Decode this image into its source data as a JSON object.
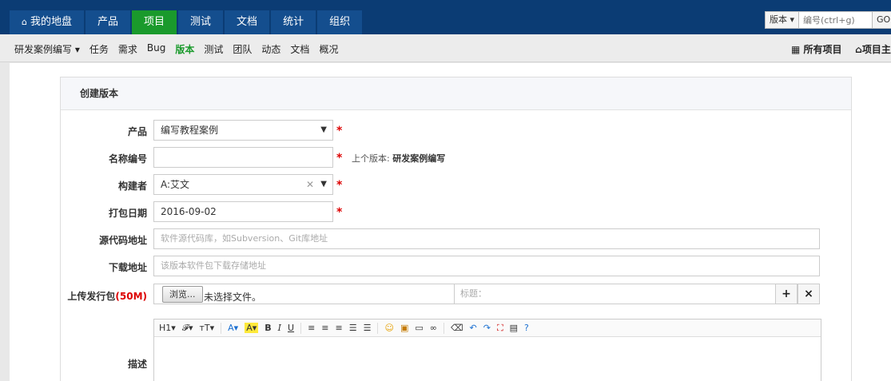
{
  "colors": {
    "topbar": "#0b3c74",
    "active_tab": "#1a9a2c",
    "required": "#dd0000"
  },
  "main_nav": [
    {
      "label": "我的地盘",
      "icon": "home-icon"
    },
    {
      "label": "产品"
    },
    {
      "label": "项目",
      "active": true
    },
    {
      "label": "测试"
    },
    {
      "label": "文档"
    },
    {
      "label": "统计"
    },
    {
      "label": "组织"
    }
  ],
  "search": {
    "type_label": "版本",
    "placeholder": "编号(ctrl+g)",
    "go": "GO"
  },
  "sub_nav": {
    "project": "研发案例编写",
    "items": [
      "任务",
      "需求",
      "Bug",
      "版本",
      "测试",
      "团队",
      "动态",
      "文档",
      "概况"
    ],
    "active": "版本",
    "all_projects": "所有项目",
    "project_home": "项目主页"
  },
  "form": {
    "title": "创建版本",
    "product_label": "产品",
    "product_value": "编写教程案例",
    "name_label": "名称编号",
    "name_value": "",
    "last_version_prefix": "上个版本:",
    "last_version_value": "研发案例编写",
    "builder_label": "构建者",
    "builder_value": "A:艾文",
    "date_label": "打包日期",
    "date_value": "2016-09-02",
    "scm_label": "源代码地址",
    "scm_placeholder": "软件源代码库，如Subversion、Git库地址",
    "download_label": "下载地址",
    "download_placeholder": "该版本软件包下载存储地址",
    "upload_label": "上传发行包",
    "upload_limit": "(50M)",
    "browse_label": "浏览...",
    "no_file": "未选择文件。",
    "file_title_placeholder": "标题：",
    "desc_label": "描述",
    "required_mark": "*"
  },
  "editor_toolbar": [
    "H1",
    "𝓕",
    "тT",
    "A",
    "A",
    "B",
    "I",
    "U"
  ]
}
